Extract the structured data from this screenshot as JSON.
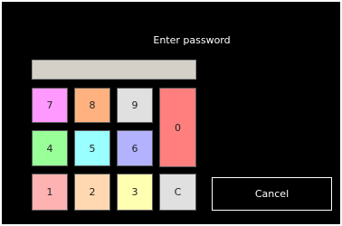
{
  "dialog": {
    "title": "Enter password",
    "password_value": ""
  },
  "keypad": {
    "keys": [
      {
        "label": "7",
        "color": "#ff99ff"
      },
      {
        "label": "8",
        "color": "#ffb27f"
      },
      {
        "label": "9",
        "color": "#e0e0e0"
      },
      {
        "label": "0",
        "color": "#ff7f7f"
      },
      {
        "label": "4",
        "color": "#99ff99"
      },
      {
        "label": "5",
        "color": "#99ffff"
      },
      {
        "label": "6",
        "color": "#b2b2ff"
      },
      {
        "label": "1",
        "color": "#ffb2b2"
      },
      {
        "label": "2",
        "color": "#ffd8b2"
      },
      {
        "label": "3",
        "color": "#ffffb2"
      },
      {
        "label": "C",
        "color": "#e0e0e0"
      }
    ]
  },
  "actions": {
    "cancel_label": "Cancel"
  }
}
